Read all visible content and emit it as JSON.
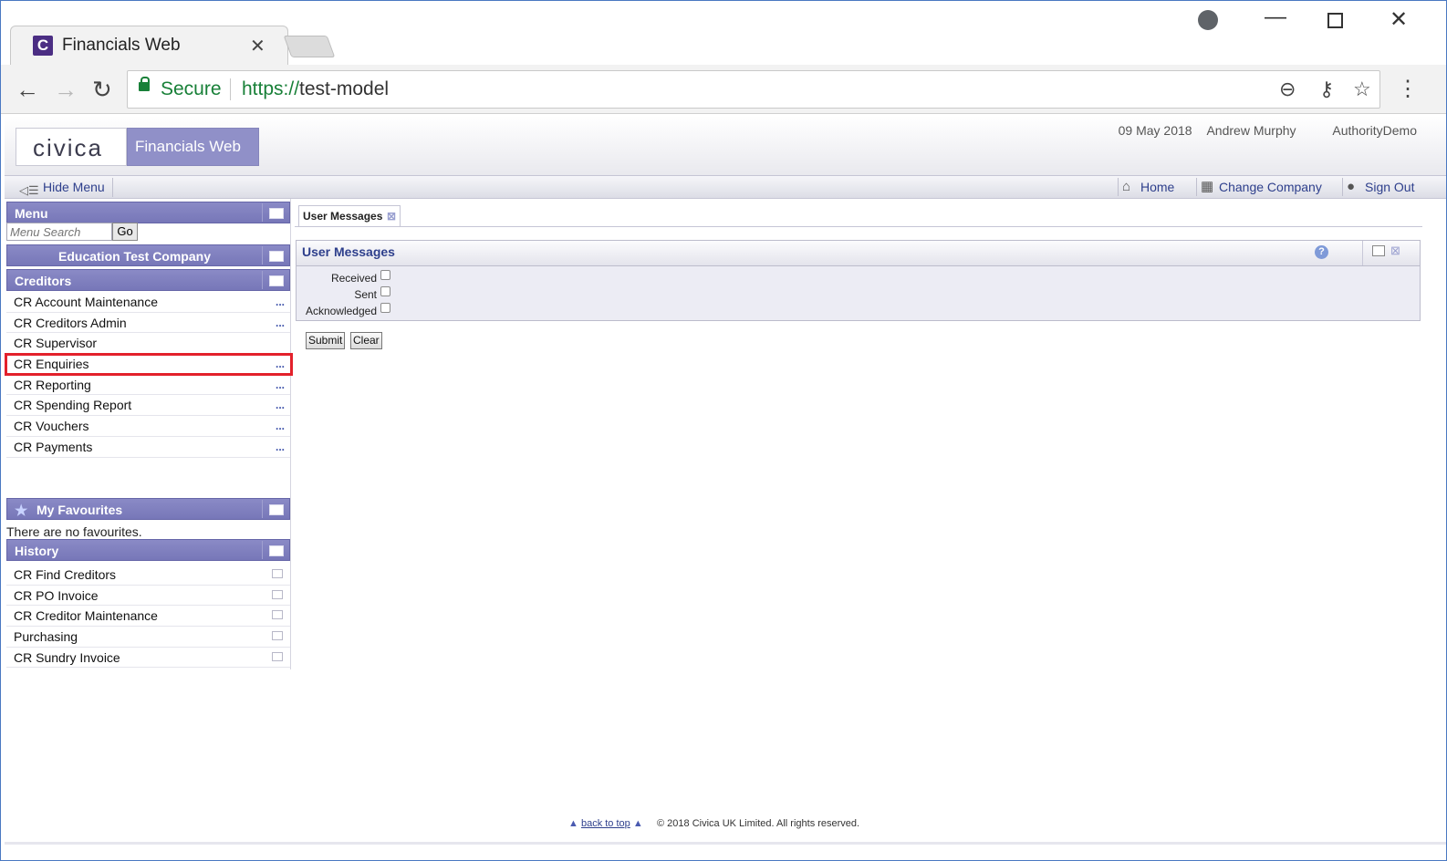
{
  "browser": {
    "tab_title": "Financials Web",
    "tab_close": "✕",
    "secure_label": "Secure",
    "url_scheme": "https://",
    "url_host": "test-model"
  },
  "header": {
    "logo": "civica",
    "product": "Financials Web",
    "date": "09 May 2018",
    "user": "Andrew Murphy",
    "company": "AuthorityDemo"
  },
  "toolbar": {
    "hide_menu": "Hide Menu",
    "home": "Home",
    "change_company": "Change Company",
    "sign_out": "Sign Out"
  },
  "menu": {
    "title": "Menu",
    "search_placeholder": "Menu Search",
    "go": "Go",
    "company": "Education Test Company",
    "section": "Creditors",
    "items": [
      {
        "label": "CR Account Maintenance",
        "more": "..."
      },
      {
        "label": "CR Creditors Admin",
        "more": "..."
      },
      {
        "label": "CR Supervisor",
        "more": ""
      },
      {
        "label": "CR Enquiries",
        "more": "..."
      },
      {
        "label": "CR Reporting",
        "more": "..."
      },
      {
        "label": "CR Spending Report",
        "more": "..."
      },
      {
        "label": "CR Vouchers",
        "more": "..."
      },
      {
        "label": "CR Payments",
        "more": "..."
      }
    ]
  },
  "favourites": {
    "title": "My Favourites",
    "empty_text": "There are no favourites."
  },
  "history": {
    "title": "History",
    "items": [
      {
        "label": "CR Find Creditors"
      },
      {
        "label": "CR PO Invoice"
      },
      {
        "label": "CR Creditor Maintenance"
      },
      {
        "label": "Purchasing"
      },
      {
        "label": "CR Sundry Invoice"
      }
    ]
  },
  "main": {
    "tab_label": "User Messages",
    "panel_title": "User Messages",
    "filters": {
      "received": "Received",
      "sent": "Sent",
      "acknowledged": "Acknowledged"
    },
    "submit": "Submit",
    "clear": "Clear"
  },
  "footer": {
    "back_to_top": "back to top",
    "copyright": "© 2018 Civica UK Limited. All rights reserved."
  }
}
